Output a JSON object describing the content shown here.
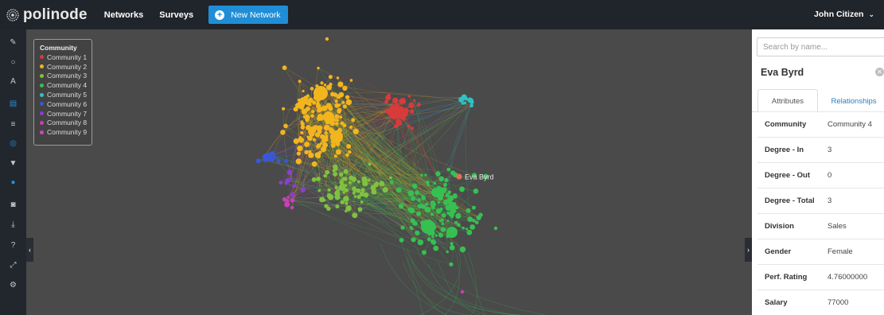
{
  "topbar": {
    "brand": "polinode",
    "nav": [
      "Networks",
      "Surveys"
    ],
    "new_network_label": "New Network",
    "user_name": "John Citizen"
  },
  "toolbar": {
    "tools": [
      {
        "icon": "pencil-icon",
        "glyph": "✎"
      },
      {
        "icon": "circle-icon",
        "glyph": "○"
      },
      {
        "icon": "font-icon",
        "glyph": "A"
      },
      {
        "icon": "clipboard-icon",
        "glyph": "▤",
        "active": true
      },
      {
        "icon": "list-icon",
        "glyph": "≡"
      },
      {
        "icon": "target-icon",
        "glyph": "◎",
        "active": true
      },
      {
        "icon": "filter-icon",
        "glyph": "▼"
      },
      {
        "icon": "drop-icon",
        "glyph": "●",
        "active": true
      },
      {
        "icon": "camera-icon",
        "glyph": "◙"
      },
      {
        "icon": "download-icon",
        "glyph": "⤓"
      },
      {
        "icon": "help-icon",
        "glyph": "?"
      },
      {
        "icon": "expand-icon",
        "glyph": "⤢"
      },
      {
        "icon": "gear-icon",
        "glyph": "⚙"
      }
    ]
  },
  "legend": {
    "title": "Community",
    "items": [
      {
        "label": "Community 1",
        "color": "#d93a3a"
      },
      {
        "label": "Community 2",
        "color": "#f2b51d"
      },
      {
        "label": "Community 3",
        "color": "#7fc241"
      },
      {
        "label": "Community 4",
        "color": "#37c052"
      },
      {
        "label": "Community 5",
        "color": "#2fc2c2"
      },
      {
        "label": "Community 6",
        "color": "#3a57d6"
      },
      {
        "label": "Community 7",
        "color": "#8a3fd0"
      },
      {
        "label": "Community 8",
        "color": "#c93fb8"
      },
      {
        "label": "Community 9",
        "color": "#d046c9"
      }
    ]
  },
  "graph": {
    "highlighted_node": {
      "label": "Eva Byrd",
      "color": "#e0705a"
    }
  },
  "panel": {
    "search_placeholder": "Search by name...",
    "node_name": "Eva Byrd",
    "tabs": [
      "Attributes",
      "Relationships"
    ],
    "attributes": [
      {
        "key": "Community",
        "value": "Community 4"
      },
      {
        "key": "Degree - In",
        "value": "3"
      },
      {
        "key": "Degree - Out",
        "value": "0"
      },
      {
        "key": "Degree - Total",
        "value": "3"
      },
      {
        "key": "Division",
        "value": "Sales"
      },
      {
        "key": "Gender",
        "value": "Female"
      },
      {
        "key": "Perf. Rating",
        "value": "4.76000000"
      },
      {
        "key": "Salary",
        "value": "77000"
      }
    ]
  },
  "colors": {
    "accent": "#1f8ed6",
    "topbar": "#20242b",
    "canvas": "#4a4a4a"
  }
}
